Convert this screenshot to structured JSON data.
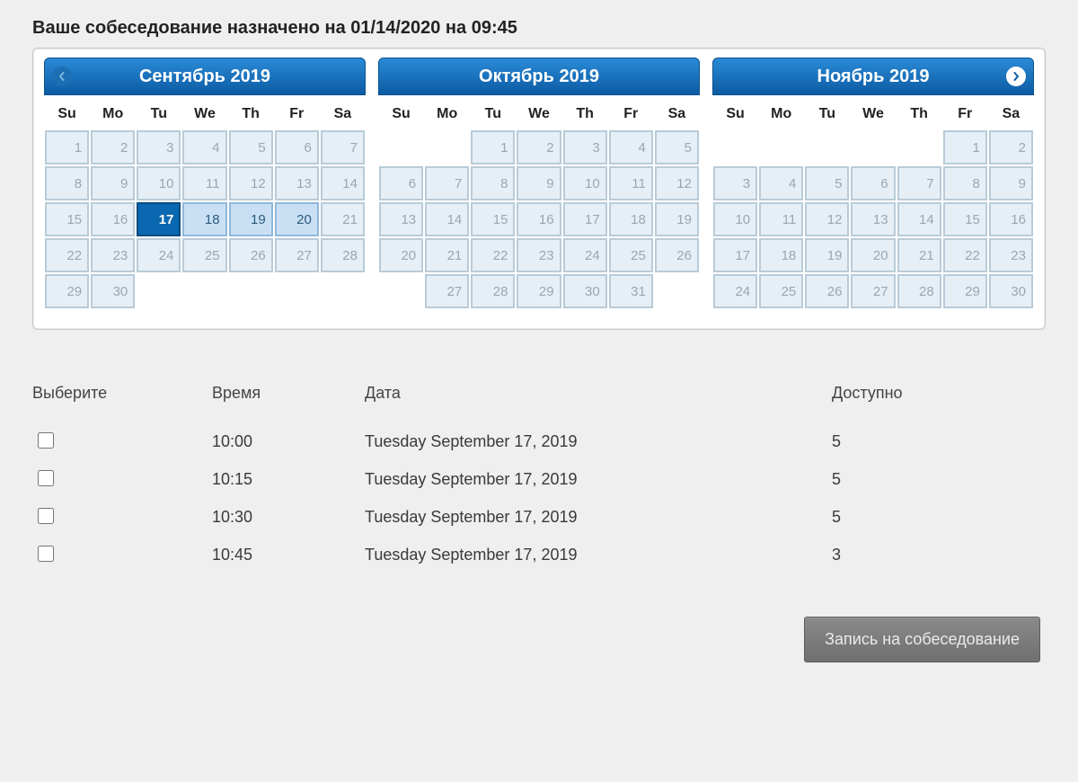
{
  "title": "Ваше собеседование назначено на 01/14/2020 на 09:45",
  "dow": [
    "Su",
    "Mo",
    "Tu",
    "We",
    "Th",
    "Fr",
    "Sa"
  ],
  "months": [
    {
      "id": "sep-2019",
      "title": "Сентябрь 2019",
      "nav": "prev",
      "weeks": [
        [
          {
            "n": 1,
            "s": "disabled"
          },
          {
            "n": 2,
            "s": "disabled"
          },
          {
            "n": 3,
            "s": "disabled"
          },
          {
            "n": 4,
            "s": "disabled"
          },
          {
            "n": 5,
            "s": "disabled"
          },
          {
            "n": 6,
            "s": "disabled"
          },
          {
            "n": 7,
            "s": "disabled"
          }
        ],
        [
          {
            "n": 8,
            "s": "disabled"
          },
          {
            "n": 9,
            "s": "disabled"
          },
          {
            "n": 10,
            "s": "disabled"
          },
          {
            "n": 11,
            "s": "disabled"
          },
          {
            "n": 12,
            "s": "disabled"
          },
          {
            "n": 13,
            "s": "disabled"
          },
          {
            "n": 14,
            "s": "disabled"
          }
        ],
        [
          {
            "n": 15,
            "s": "disabled"
          },
          {
            "n": 16,
            "s": "disabled"
          },
          {
            "n": 17,
            "s": "selected"
          },
          {
            "n": 18,
            "s": "avail"
          },
          {
            "n": 19,
            "s": "avail"
          },
          {
            "n": 20,
            "s": "avail"
          },
          {
            "n": 21,
            "s": "disabled"
          }
        ],
        [
          {
            "n": 22,
            "s": "disabled"
          },
          {
            "n": 23,
            "s": "disabled"
          },
          {
            "n": 24,
            "s": "disabled"
          },
          {
            "n": 25,
            "s": "disabled"
          },
          {
            "n": 26,
            "s": "disabled"
          },
          {
            "n": 27,
            "s": "disabled"
          },
          {
            "n": 28,
            "s": "disabled"
          }
        ],
        [
          {
            "n": 29,
            "s": "disabled"
          },
          {
            "n": 30,
            "s": "disabled"
          },
          {
            "s": "empty"
          },
          {
            "s": "empty"
          },
          {
            "s": "empty"
          },
          {
            "s": "empty"
          },
          {
            "s": "empty"
          }
        ]
      ]
    },
    {
      "id": "oct-2019",
      "title": "Октябрь 2019",
      "nav": "none",
      "weeks": [
        [
          {
            "s": "empty"
          },
          {
            "s": "empty"
          },
          {
            "n": 1,
            "s": "disabled"
          },
          {
            "n": 2,
            "s": "disabled"
          },
          {
            "n": 3,
            "s": "disabled"
          },
          {
            "n": 4,
            "s": "disabled"
          },
          {
            "n": 5,
            "s": "disabled"
          }
        ],
        [
          {
            "n": 6,
            "s": "disabled"
          },
          {
            "n": 7,
            "s": "disabled"
          },
          {
            "n": 8,
            "s": "disabled"
          },
          {
            "n": 9,
            "s": "disabled"
          },
          {
            "n": 10,
            "s": "disabled"
          },
          {
            "n": 11,
            "s": "disabled"
          },
          {
            "n": 12,
            "s": "disabled"
          }
        ],
        [
          {
            "n": 13,
            "s": "disabled"
          },
          {
            "n": 14,
            "s": "disabled"
          },
          {
            "n": 15,
            "s": "disabled"
          },
          {
            "n": 16,
            "s": "disabled"
          },
          {
            "n": 17,
            "s": "disabled"
          },
          {
            "n": 18,
            "s": "disabled"
          },
          {
            "n": 19,
            "s": "disabled"
          }
        ],
        [
          {
            "n": 20,
            "s": "disabled"
          },
          {
            "n": 21,
            "s": "disabled"
          },
          {
            "n": 22,
            "s": "disabled"
          },
          {
            "n": 23,
            "s": "disabled"
          },
          {
            "n": 24,
            "s": "disabled"
          },
          {
            "n": 25,
            "s": "disabled"
          },
          {
            "n": 26,
            "s": "disabled"
          }
        ],
        [
          {
            "s": "empty"
          },
          {
            "n": 27,
            "s": "disabled"
          },
          {
            "n": 28,
            "s": "disabled"
          },
          {
            "n": 29,
            "s": "disabled"
          },
          {
            "n": 30,
            "s": "disabled"
          },
          {
            "n": 31,
            "s": "disabled"
          },
          {
            "s": "empty"
          }
        ]
      ]
    },
    {
      "id": "nov-2019",
      "title": "Ноябрь 2019",
      "nav": "next",
      "weeks": [
        [
          {
            "s": "empty"
          },
          {
            "s": "empty"
          },
          {
            "s": "empty"
          },
          {
            "s": "empty"
          },
          {
            "s": "empty"
          },
          {
            "n": 1,
            "s": "disabled"
          },
          {
            "n": 2,
            "s": "disabled"
          }
        ],
        [
          {
            "n": 3,
            "s": "disabled"
          },
          {
            "n": 4,
            "s": "disabled"
          },
          {
            "n": 5,
            "s": "disabled"
          },
          {
            "n": 6,
            "s": "disabled"
          },
          {
            "n": 7,
            "s": "disabled"
          },
          {
            "n": 8,
            "s": "disabled"
          },
          {
            "n": 9,
            "s": "disabled"
          }
        ],
        [
          {
            "n": 10,
            "s": "disabled"
          },
          {
            "n": 11,
            "s": "disabled"
          },
          {
            "n": 12,
            "s": "disabled"
          },
          {
            "n": 13,
            "s": "disabled"
          },
          {
            "n": 14,
            "s": "disabled"
          },
          {
            "n": 15,
            "s": "disabled"
          },
          {
            "n": 16,
            "s": "disabled"
          }
        ],
        [
          {
            "n": 17,
            "s": "disabled"
          },
          {
            "n": 18,
            "s": "disabled"
          },
          {
            "n": 19,
            "s": "disabled"
          },
          {
            "n": 20,
            "s": "disabled"
          },
          {
            "n": 21,
            "s": "disabled"
          },
          {
            "n": 22,
            "s": "disabled"
          },
          {
            "n": 23,
            "s": "disabled"
          }
        ],
        [
          {
            "n": 24,
            "s": "disabled"
          },
          {
            "n": 25,
            "s": "disabled"
          },
          {
            "n": 26,
            "s": "disabled"
          },
          {
            "n": 27,
            "s": "disabled"
          },
          {
            "n": 28,
            "s": "disabled"
          },
          {
            "n": 29,
            "s": "disabled"
          },
          {
            "n": 30,
            "s": "disabled"
          }
        ]
      ]
    }
  ],
  "slots": {
    "headers": {
      "select": "Выберите",
      "time": "Время",
      "date": "Дата",
      "available": "Доступно"
    },
    "rows": [
      {
        "time": "10:00",
        "date": "Tuesday September 17, 2019",
        "available": "5"
      },
      {
        "time": "10:15",
        "date": "Tuesday September 17, 2019",
        "available": "5"
      },
      {
        "time": "10:30",
        "date": "Tuesday September 17, 2019",
        "available": "5"
      },
      {
        "time": "10:45",
        "date": "Tuesday September 17, 2019",
        "available": "3"
      }
    ]
  },
  "submit_label": "Запись на собеседование"
}
